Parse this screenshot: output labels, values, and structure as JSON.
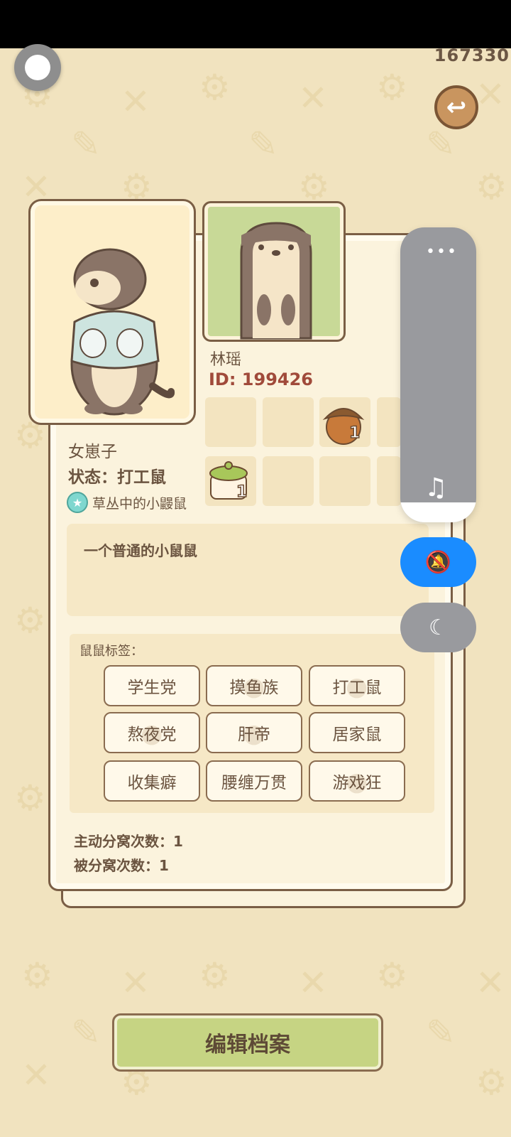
{
  "status_bar": {},
  "header": {
    "coins": "167330",
    "back_icon": "curved-arrow-back-icon"
  },
  "profile": {
    "nickname": "林瑶",
    "id": "ID: 199426",
    "gender": "女崽子",
    "status": "状态：打工鼠",
    "achievement": "草丛中的小鼹鼠",
    "bio": "一个普通的小鼠鼠"
  },
  "inventory": [
    {
      "icon": "acorn-icon",
      "count": "1"
    },
    {
      "icon": "pot-icon",
      "count": "1"
    }
  ],
  "tags": {
    "title": "鼠鼠标签：",
    "items": [
      "学生党",
      "摸鱼族",
      "打工鼠",
      "熬夜党",
      "肝帝",
      "居家鼠",
      "收集癖",
      "腰缠万贯",
      "游戏狂"
    ]
  },
  "counts": {
    "active": "主动分窝次数：1",
    "passive": "被分窝次数：1"
  },
  "side_panel": {
    "menu": "•••",
    "music_icon": "♫",
    "mute_icon": "bell-off-icon",
    "night_icon": "moon-icon"
  },
  "edit_button": "编辑档案",
  "colors": {
    "background": "#f1e3bf",
    "accent_green": "#c6d483",
    "mute_blue": "#1a8cff",
    "id_red": "#a04a3a"
  }
}
